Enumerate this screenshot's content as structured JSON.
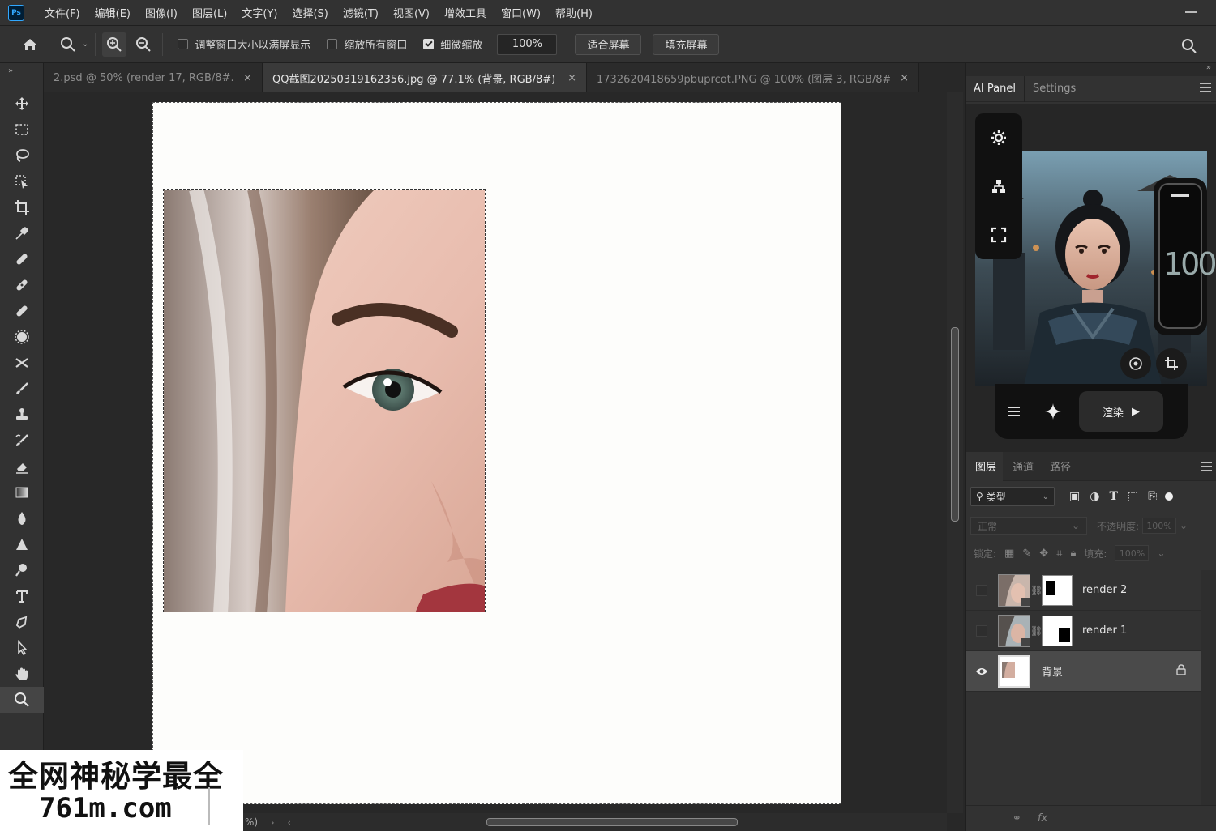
{
  "menubar": {
    "app_icon": "Ps",
    "items": [
      "文件(F)",
      "编辑(E)",
      "图像(I)",
      "图层(L)",
      "文字(Y)",
      "选择(S)",
      "滤镜(T)",
      "视图(V)",
      "增效工具",
      "窗口(W)",
      "帮助(H)"
    ]
  },
  "options": {
    "resize_windows_label": "调整窗口大小以满屏显示",
    "resize_windows_checked": false,
    "zoom_all_label": "缩放所有窗口",
    "zoom_all_checked": false,
    "scrubby_zoom_label": "细微缩放",
    "scrubby_zoom_checked": true,
    "zoom_value": "100%",
    "fit_screen_label": "适合屏幕",
    "fill_screen_label": "填充屏幕"
  },
  "tabs": [
    {
      "label": "2.psd @ 50% (render 17, RGB/8#...",
      "active": false
    },
    {
      "label": "QQ截图20250319162356.jpg @ 77.1% (背景, RGB/8#) *",
      "active": true
    },
    {
      "label": "1732620418659pbuprcot.PNG @ 100% (图层 3, RGB/8#...",
      "active": false
    }
  ],
  "status": {
    "text": "%)"
  },
  "watermark": {
    "line1": "全网神秘学最全",
    "line2": "761m.com"
  },
  "right_panel": {
    "tabs": [
      "AI Panel",
      "Settings"
    ],
    "slider_value": "100",
    "render_label": "渲染"
  },
  "layers_panel": {
    "tabs": [
      "图层",
      "通道",
      "路径"
    ],
    "kind_label": "类型",
    "blend_mode": "正常",
    "opacity_label": "不透明度:",
    "opacity_value": "100%",
    "lock_label": "锁定:",
    "fill_label": "填充:",
    "fill_value": "100%",
    "layers": [
      {
        "name": "render 2",
        "visible": false,
        "has_mask": true,
        "selected": false
      },
      {
        "name": "render 1",
        "visible": false,
        "has_mask": true,
        "selected": false
      },
      {
        "name": "背景",
        "visible": true,
        "has_mask": false,
        "selected": true,
        "locked": true
      }
    ],
    "footer": [
      "link-icon",
      "fx"
    ],
    "fx_label": "fx"
  }
}
